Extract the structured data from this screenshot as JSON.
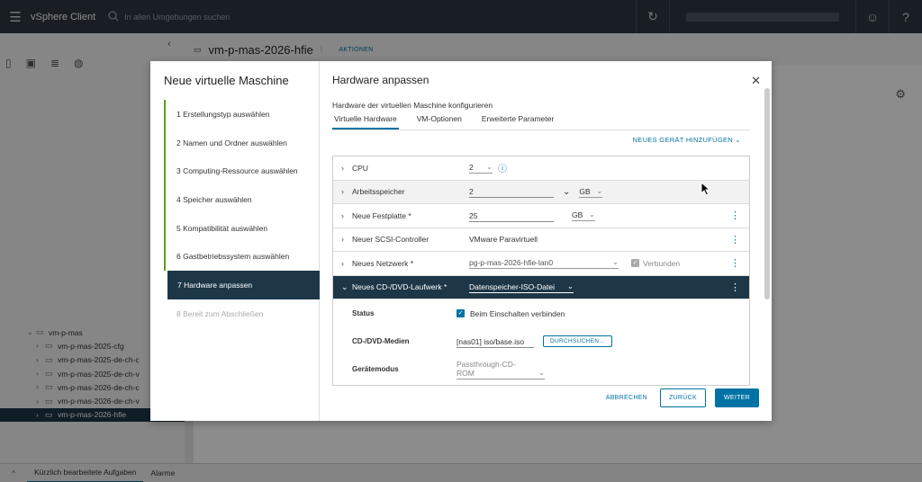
{
  "topbar": {
    "app_title": "vSphere Client",
    "search_placeholder": "In allen Umgebungen suchen",
    "icons": [
      "menu-icon",
      "search-icon",
      "refresh-icon",
      "user-icon",
      "help-icon"
    ]
  },
  "navigator": {
    "tree": [
      {
        "label": "vm-p-mas",
        "depth": 0,
        "expanded": true
      },
      {
        "label": "vm-p-mas-2025-cfg",
        "depth": 1
      },
      {
        "label": "vm-p-mas-2025-de-ch-c",
        "depth": 1
      },
      {
        "label": "vm-p-mas-2025-de-ch-v",
        "depth": 1
      },
      {
        "label": "vm-p-mas-2026-de-ch-c",
        "depth": 1
      },
      {
        "label": "vm-p-mas-2026-de-ch-v",
        "depth": 1
      },
      {
        "label": "vm-p-mas-2026-hfie",
        "depth": 1,
        "selected": true
      }
    ]
  },
  "main": {
    "vm_title": "vm-p-mas-2026-hfie",
    "actions_label": "AKTIONEN"
  },
  "bottombar": {
    "tabs": [
      "Kürzlich bearbeitete Aufgaben",
      "Alarme"
    ]
  },
  "wizard": {
    "title": "Neue virtuelle Maschine",
    "steps": [
      {
        "label": "1  Erstellungstyp auswählen",
        "state": "done"
      },
      {
        "label": "2  Namen und Ordner auswählen",
        "state": "done"
      },
      {
        "label": "3  Computing-Ressource auswählen",
        "state": "done"
      },
      {
        "label": "4  Speicher auswählen",
        "state": "done"
      },
      {
        "label": "5  Kompatibilität auswählen",
        "state": "done"
      },
      {
        "label": "6  Gastbetriebssystem auswählen",
        "state": "done"
      },
      {
        "label": "7  Hardware anpassen",
        "state": "active"
      },
      {
        "label": "8  Bereit zum Abschließen",
        "state": "disabled"
      }
    ],
    "content": {
      "title": "Hardware anpassen",
      "subtitle": "Hardware der virtuellen Maschine konfigurieren",
      "tabs": [
        "Virtuelle Hardware",
        "VM-Optionen",
        "Erweiterte Parameter"
      ],
      "add_device": "NEUES GERÄT HINZUFÜGEN",
      "rows": {
        "cpu": {
          "label": "CPU",
          "value": "2"
        },
        "memory": {
          "label": "Arbeitsspeicher",
          "value": "2",
          "unit": "GB"
        },
        "disk": {
          "label": "Neue Festplatte *",
          "value": "25",
          "unit": "GB"
        },
        "scsi": {
          "label": "Neuer SCSI-Controller",
          "value": "VMware Paravirtuell"
        },
        "network": {
          "label": "Neues Netzwerk *",
          "value": "pg-p-mas-2026-hfie-lan0",
          "connected_label": "Verbunden"
        },
        "cdrom": {
          "label": "Neues CD-/DVD-Laufwerk *",
          "value": "Datenspeicher-ISO-Datei"
        }
      },
      "cd_details": {
        "status_label": "Status",
        "status_value": "Beim Einschalten verbinden",
        "media_label": "CD-/DVD-Medien",
        "media_value": "[nas01] iso/base.iso",
        "browse": "DURCHSUCHEN...",
        "mode_label": "Gerätemodus",
        "mode_value": "Passthrough-CD-ROM"
      }
    },
    "buttons": {
      "cancel": "ABBRECHEN",
      "back": "ZURÜCK",
      "next": "WEITER"
    }
  }
}
